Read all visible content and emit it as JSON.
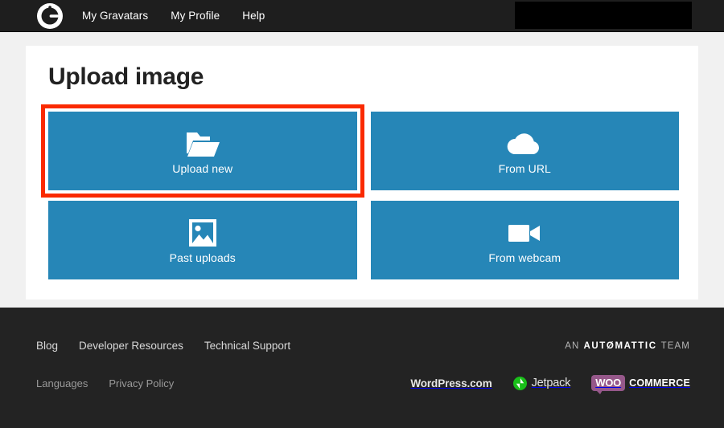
{
  "header": {
    "logo_icon": "gravatar-logo-icon",
    "nav": [
      {
        "label": "My Gravatars"
      },
      {
        "label": "My Profile"
      },
      {
        "label": "Help"
      }
    ],
    "redaction": {
      "label": ""
    }
  },
  "main": {
    "title": "Upload image",
    "tiles": [
      {
        "label": "Upload new",
        "icon": "open-folder-icon",
        "highlighted": true
      },
      {
        "label": "From URL",
        "icon": "cloud-icon",
        "highlighted": false
      },
      {
        "label": "Past uploads",
        "icon": "image-icon",
        "highlighted": false
      },
      {
        "label": "From webcam",
        "icon": "video-camera-icon",
        "highlighted": false
      }
    ]
  },
  "footer": {
    "primary_links": [
      {
        "label": "Blog"
      },
      {
        "label": "Developer Resources"
      },
      {
        "label": "Technical Support"
      }
    ],
    "secondary_links": [
      {
        "label": "Languages"
      },
      {
        "label": "Privacy Policy"
      }
    ],
    "automattic": {
      "prefix": "AN",
      "word": "AUTØMATTIC",
      "suffix": "TEAM"
    },
    "brands": [
      {
        "name": "WordPress.com"
      },
      {
        "name": "Jetpack"
      }
    ],
    "woocommerce": {
      "badge": "WOO",
      "word": "COMMERCE"
    }
  },
  "colors": {
    "tile_blue": "#2686b7",
    "highlight_red": "#fa2a00",
    "header_dark": "#1e1e1e",
    "footer_dark": "#232323",
    "page_bg": "#f1f1f1",
    "card_white": "#ffffff",
    "jetpack_green": "#19bf19",
    "woo_purple": "#96588a"
  }
}
